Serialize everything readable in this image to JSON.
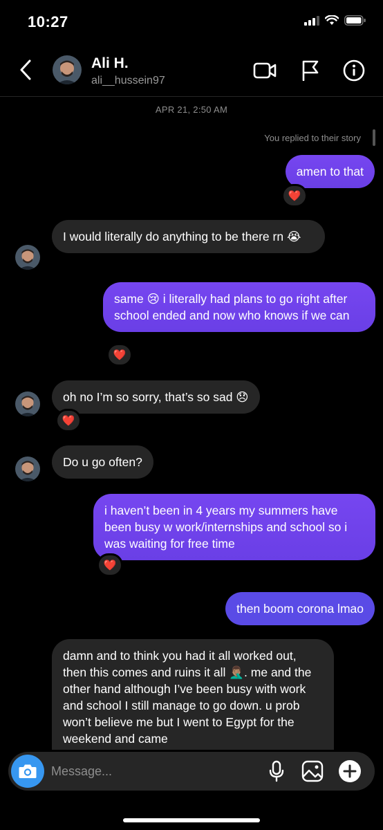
{
  "status_bar": {
    "time": "10:27"
  },
  "header": {
    "name": "Ali H.",
    "username": "ali__hussein97"
  },
  "chat": {
    "timestamp": "APR 21, 2:50 AM",
    "reply_note": "You replied to their story",
    "messages": [
      {
        "direction": "outgoing",
        "text": "amen to that",
        "reaction": "❤️"
      },
      {
        "direction": "incoming",
        "text": "I would literally do anything to be there rn 😭"
      },
      {
        "direction": "outgoing",
        "text": "same 😢 i literally had plans to go right after school ended and now who knows if we can",
        "reaction": "❤️"
      },
      {
        "direction": "incoming",
        "text": "oh no I’m so sorry, that’s so sad 😞",
        "reaction": "❤️"
      },
      {
        "direction": "incoming",
        "text": "Do u go often?"
      },
      {
        "direction": "outgoing",
        "text": "i haven’t been in 4 years my summers have been busy w work/internships and school so i was waiting for free time",
        "reaction": "❤️"
      },
      {
        "direction": "outgoing",
        "text": "then boom corona lmao"
      },
      {
        "direction": "incoming",
        "text": "damn and to think you had it all worked out, then this comes and ruins it all 🤦🏽‍♂️. me and the other hand although I’ve been busy with work and school I still manage to go down. u prob won’t believe me but I went to Egypt for the weekend and came"
      }
    ]
  },
  "composer": {
    "placeholder": "Message..."
  },
  "colors": {
    "background": "#000000",
    "incoming_bubble": "#262626",
    "outgoing_bubble": "#7042ec",
    "outgoing_bubble_blue": "#5a4be6",
    "camera_button": "#3797f0",
    "muted_text": "#8e8e8e"
  },
  "icons": [
    "back-icon",
    "video-call-icon",
    "flag-icon",
    "info-icon",
    "camera-icon",
    "microphone-icon",
    "gallery-icon",
    "plus-icon",
    "heart-icon",
    "signal-icon",
    "wifi-icon",
    "battery-icon"
  ]
}
